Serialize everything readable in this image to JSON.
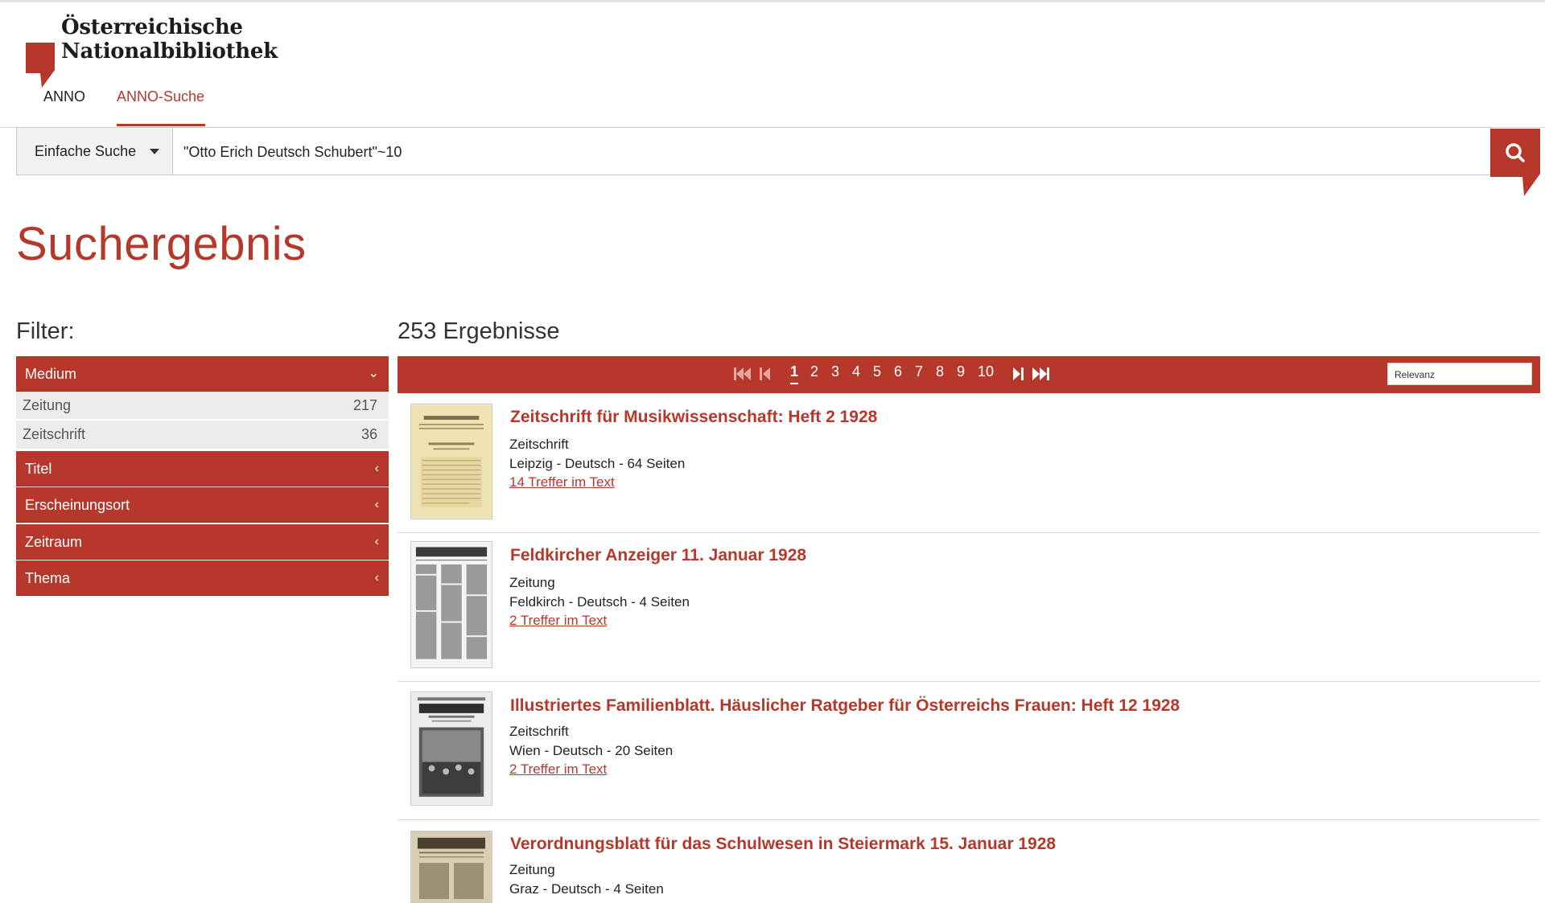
{
  "header": {
    "logo_line1": "Österreichische",
    "logo_line2": "Nationalbibliothek",
    "nav": [
      {
        "label": "ANNO"
      },
      {
        "label": "ANNO-Suche",
        "active": true
      }
    ],
    "accent_color": "#b5382b"
  },
  "search": {
    "type_label": "Einfache Suche",
    "query": "\"Otto Erich Deutsch Schubert\"~10",
    "button_icon": "search-icon"
  },
  "page_title": "Suchergebnis",
  "filter": {
    "label": "Filter:",
    "facets": [
      {
        "label": "Medium",
        "expanded": true,
        "options": [
          {
            "label": "Zeitung",
            "count": "217"
          },
          {
            "label": "Zeitschrift",
            "count": "36"
          }
        ]
      },
      {
        "label": "Titel",
        "expanded": false
      },
      {
        "label": "Erscheinungsort",
        "expanded": false
      },
      {
        "label": "Zeitraum",
        "expanded": false
      },
      {
        "label": "Thema",
        "expanded": false
      }
    ]
  },
  "results": {
    "count_label": "253 Ergebnisse",
    "pages": [
      "1",
      "2",
      "3",
      "4",
      "5",
      "6",
      "7",
      "8",
      "9",
      "10"
    ],
    "current_page": "1",
    "sort_value": "Relevanz",
    "items": [
      {
        "title": "Zeitschrift für Musikwissenschaft: Heft 2 1928",
        "type": "Zeitschrift",
        "meta": "Leipzig - Deutsch - 64 Seiten",
        "hits": "14 Treffer im Text"
      },
      {
        "title": "Feldkircher Anzeiger 11. Januar 1928",
        "type": "Zeitung",
        "meta": "Feldkirch - Deutsch - 4 Seiten",
        "hits": "2 Treffer im Text"
      },
      {
        "title": "Illustriertes Familienblatt. Häuslicher Ratgeber für Österreichs Frauen: Heft 12 1928",
        "type": "Zeitschrift",
        "meta": "Wien - Deutsch - 20 Seiten",
        "hits": "2 Treffer im Text"
      },
      {
        "title": "Verordnungsblatt für das Schulwesen in Steiermark 15. Januar 1928",
        "type": "Zeitung",
        "meta": "Graz - Deutsch - 4 Seiten",
        "hits": ""
      }
    ]
  }
}
